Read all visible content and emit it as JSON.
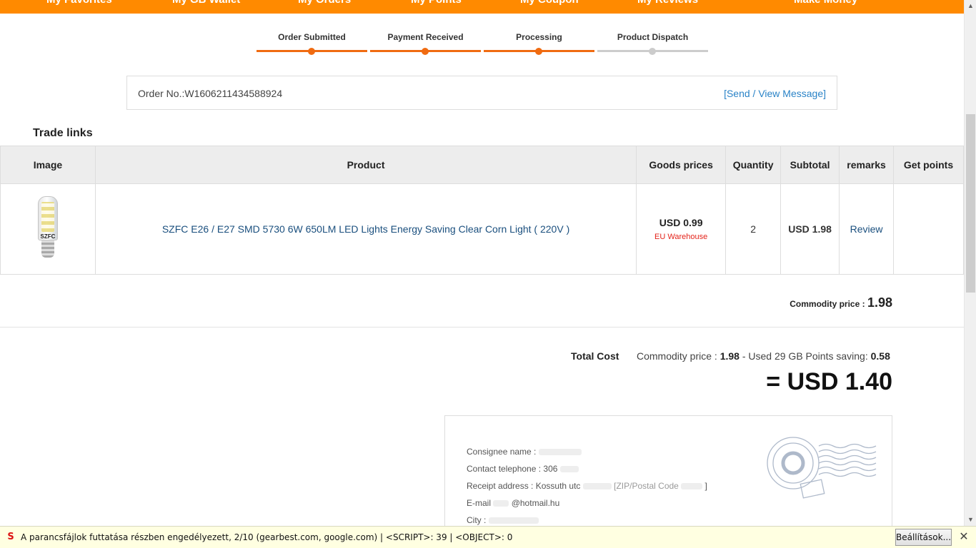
{
  "nav": [
    "My Favorites",
    "My GB Wallet",
    "My Orders",
    "My Points",
    "My Coupon",
    "My Reviews",
    "Make Money"
  ],
  "steps": [
    {
      "label": "Order Submitted",
      "done": true
    },
    {
      "label": "Payment Received",
      "done": true
    },
    {
      "label": "Processing",
      "done": true
    },
    {
      "label": "Product Dispatch",
      "done": false
    }
  ],
  "order": {
    "number": "Order No.:W1606211434588924",
    "message_link": "[Send / View Message]"
  },
  "section_title": "Trade links",
  "table": {
    "headers": [
      "Image",
      "Product",
      "Goods prices",
      "Quantity",
      "Subtotal",
      "remarks",
      "Get points"
    ],
    "row": {
      "product": "SZFC E26 / E27 SMD 5730 6W 650LM LED Lights Energy Saving Clear Corn Light ( 220V )",
      "image_brand": "SZFC",
      "price": "USD 0.99",
      "warehouse": "EU Warehouse",
      "quantity": "2",
      "subtotal": "USD 1.98",
      "remark": "Review",
      "points": ""
    }
  },
  "commodity": {
    "label": "Commodity price :",
    "value": "1.98"
  },
  "total": {
    "label": "Total Cost",
    "calc_prefix": "Commodity price :",
    "calc_value": "1.98",
    "calc_mid": "- Used 29 GB Points saving:",
    "saving": "0.58",
    "grand": "= USD 1.40"
  },
  "address": {
    "consignee_label": "Consignee name :",
    "phone_label": "Contact telephone :",
    "phone_value": "306",
    "receipt_label": "Receipt address :",
    "receipt_value": "Kossuth utc",
    "zip_label": "[ZIP/Postal Code",
    "zip_end": "]",
    "email_label": "E-mail",
    "email_value": "@hotmail.hu",
    "city_label": "City :"
  },
  "notification": {
    "text": "A parancsfájlok futtatása részben engedélyezett, 2/10 (gearbest.com, google.com) | <SCRIPT>: 39 | <OBJECT>: 0",
    "button": "Beállítások...",
    "icon": "noscript-icon"
  },
  "colors": {
    "accent": "#ff8a00",
    "step": "#f06b11",
    "link": "#2a83c7",
    "warning": "#e4231a"
  }
}
